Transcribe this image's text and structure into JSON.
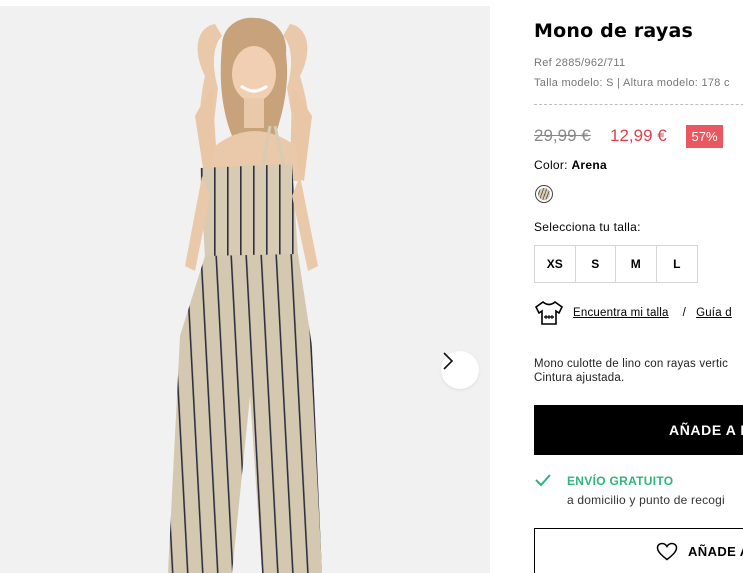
{
  "product": {
    "title": "Mono de rayas",
    "ref": "Ref 2885/962/711",
    "model_info": "Talla modelo: S | Altura modelo: 178 c",
    "old_price": "29,99 €",
    "new_price": "12,99 €",
    "discount": "57%",
    "color_label": "Color:",
    "color_name": "Arena",
    "size_label": "Selecciona tu talla:",
    "sizes": [
      "XS",
      "S",
      "M",
      "L"
    ],
    "find_size": "Encuentra mi talla",
    "separator": "/",
    "size_guide": "Guía d",
    "description_line1": "Mono culotte de lino con rayas vertic",
    "description_line2": "Cintura ajustada.",
    "add_to_cart": "AÑADE A L",
    "shipping_title": "ENVÍO GRATUITO",
    "shipping_sub": "a domicilio y punto de recogi",
    "wishlist": "AÑADE A"
  },
  "icons": {
    "next": "chevron-right-icon",
    "fit": "tshirt-ruler-icon",
    "check": "check-icon",
    "heart": "heart-icon"
  },
  "colors": {
    "sale_price": "#e0404b",
    "discount_badge": "#e95861",
    "shipping_green": "#2fb57d",
    "cta_black": "#000000"
  }
}
